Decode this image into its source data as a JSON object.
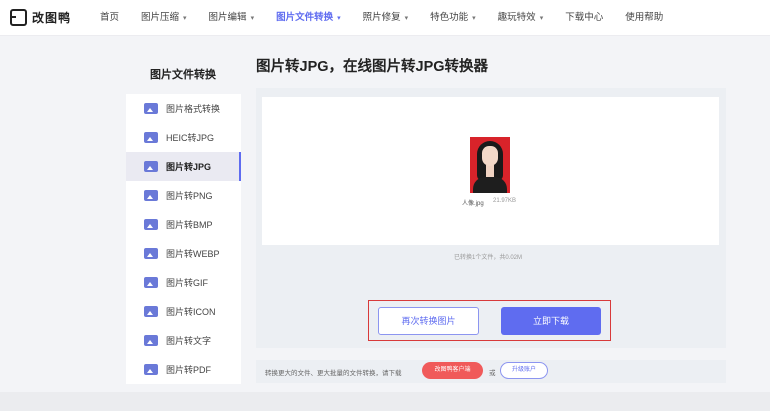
{
  "app": {
    "name": "改图鸭"
  },
  "nav": {
    "items": [
      {
        "label": "首页",
        "has_dropdown": false,
        "active": false
      },
      {
        "label": "图片压缩",
        "has_dropdown": true,
        "active": false
      },
      {
        "label": "图片编辑",
        "has_dropdown": true,
        "active": false
      },
      {
        "label": "图片文件转换",
        "has_dropdown": true,
        "active": true
      },
      {
        "label": "照片修复",
        "has_dropdown": true,
        "active": false
      },
      {
        "label": "特色功能",
        "has_dropdown": true,
        "active": false
      },
      {
        "label": "趣玩特效",
        "has_dropdown": true,
        "active": false
      },
      {
        "label": "下载中心",
        "has_dropdown": false,
        "active": false
      },
      {
        "label": "使用帮助",
        "has_dropdown": false,
        "active": false
      }
    ],
    "chevron": "▾"
  },
  "sidebar": {
    "title": "图片文件转换",
    "items": [
      {
        "label": "图片格式转换",
        "icon": "image-icon",
        "active": false
      },
      {
        "label": "HEIC转JPG",
        "icon": "image-icon",
        "active": false
      },
      {
        "label": "图片转JPG",
        "icon": "image-icon",
        "active": true
      },
      {
        "label": "图片转PNG",
        "icon": "image-icon",
        "active": false
      },
      {
        "label": "图片转BMP",
        "icon": "image-icon",
        "active": false
      },
      {
        "label": "图片转WEBP",
        "icon": "image-icon",
        "active": false
      },
      {
        "label": "图片转GIF",
        "icon": "image-icon",
        "active": false
      },
      {
        "label": "图片转ICON",
        "icon": "image-icon",
        "active": false
      },
      {
        "label": "图片转文字",
        "icon": "image-icon",
        "active": false
      },
      {
        "label": "图片转PDF",
        "icon": "image-icon",
        "active": false
      }
    ]
  },
  "main": {
    "title": "图片转JPG，在线图片转JPG转换器",
    "file": {
      "name": "人像.jpg",
      "size": "21.97KB"
    },
    "conversion_info": "已转换1个文件，共0.02M",
    "buttons": {
      "convert_again": "再次转换图片",
      "download_now": "立即下载"
    }
  },
  "bottom": {
    "text": "转换更大的文件、更大批量的文件转换，请下载",
    "client_button": "改图鸭客户端",
    "or": "或",
    "upgrade_button": "升级账户"
  },
  "colors": {
    "accent": "#5f6cf0",
    "highlight_border": "#d83a3a",
    "client_button": "#f05a5a"
  }
}
